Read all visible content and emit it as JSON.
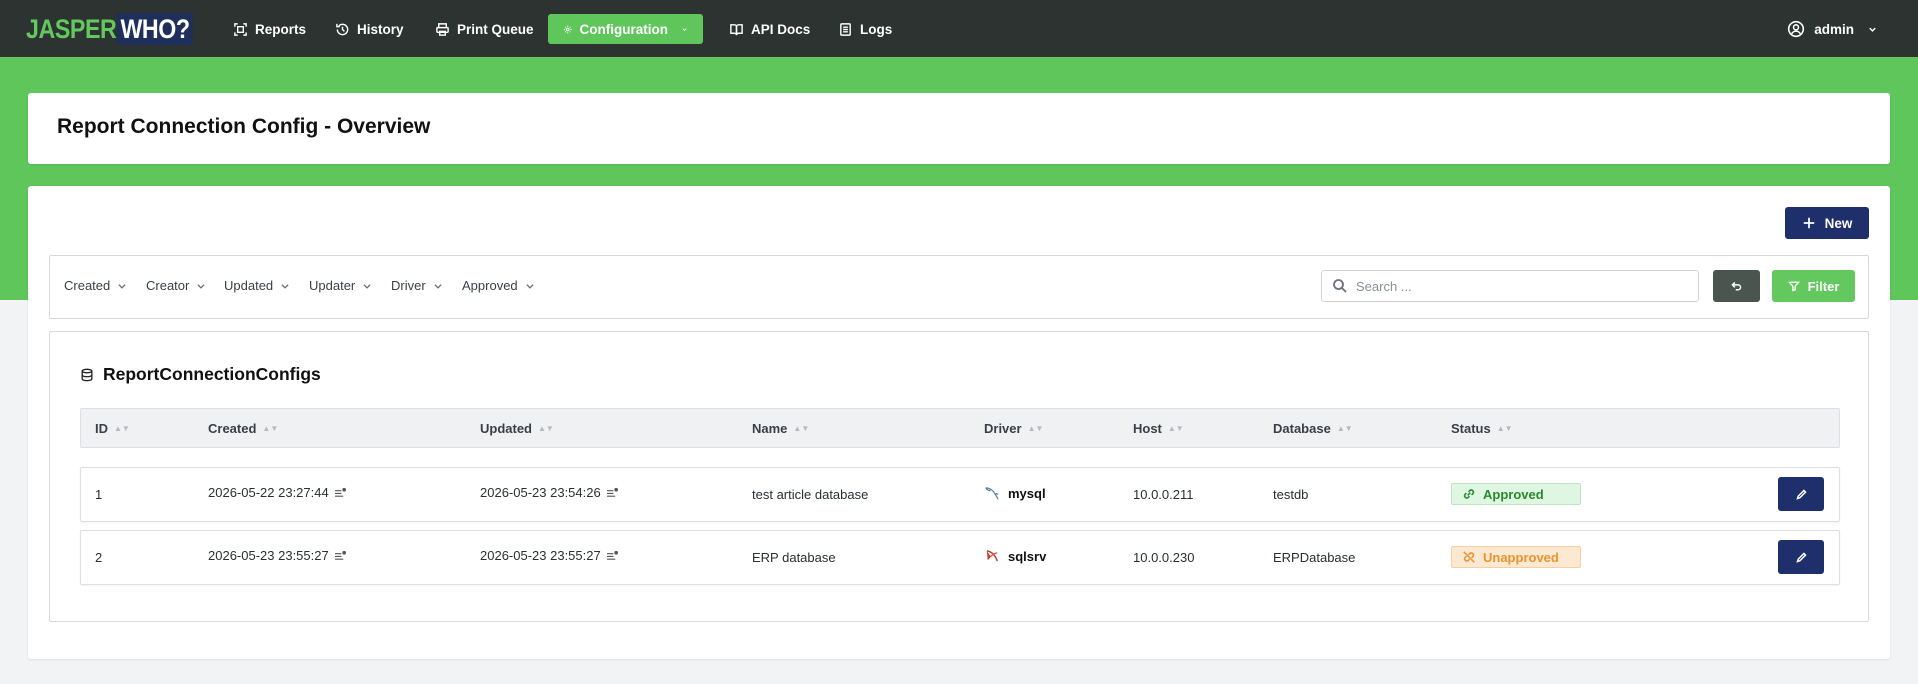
{
  "brand": {
    "part1": "JASPER",
    "part2": "WHO?"
  },
  "nav": {
    "items": [
      {
        "label": "Reports",
        "icon": "reports-icon"
      },
      {
        "label": "History",
        "icon": "history-icon"
      },
      {
        "label": "Print Queue",
        "icon": "printer-icon"
      },
      {
        "label": "Configuration",
        "icon": "gear-icon",
        "active": true
      },
      {
        "label": "API Docs",
        "icon": "book-icon"
      },
      {
        "label": "Logs",
        "icon": "logs-icon"
      }
    ],
    "user": "admin"
  },
  "page": {
    "title": "Report Connection Config - Overview"
  },
  "actions": {
    "new_label": "New"
  },
  "filters": {
    "dropdowns": [
      "Created",
      "Creator",
      "Updated",
      "Updater",
      "Driver",
      "Approved"
    ],
    "search_placeholder": "Search ...",
    "filter_label": "Filter"
  },
  "table": {
    "title": "ReportConnectionConfigs",
    "columns": [
      "ID",
      "Created",
      "Updated",
      "Name",
      "Driver",
      "Host",
      "Database",
      "Status"
    ],
    "rows": [
      {
        "id": "1",
        "created": "2026-05-22 23:27:44",
        "updated": "2026-05-23 23:54:26",
        "name": "test article database",
        "driver": "mysql",
        "host": "10.0.0.211",
        "database": "testdb",
        "status": "Approved"
      },
      {
        "id": "2",
        "created": "2026-05-23 23:55:27",
        "updated": "2026-05-23 23:55:27",
        "name": "ERP database",
        "driver": "sqlsrv",
        "host": "10.0.0.230",
        "database": "ERPDatabase",
        "status": "Unapproved"
      }
    ]
  },
  "colors": {
    "brand_green": "#5fc65c",
    "navbar": "#2d3330",
    "primary": "#1e2f6b",
    "approved": "#2b8a2f",
    "unapproved": "#e8942e"
  }
}
